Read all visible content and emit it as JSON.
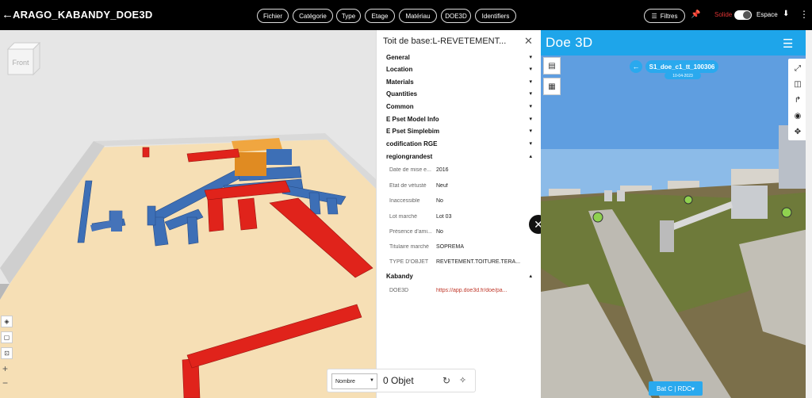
{
  "header": {
    "title": "ARAGO_KABANDY_DOE3D",
    "chips": [
      "Fichier",
      "Catégorie",
      "Type",
      "Etage",
      "Matériau",
      "DOE3D",
      "Identifiers"
    ],
    "filters_label": "Filtres",
    "solide_label": "Solide",
    "espace_label": "Espace"
  },
  "viewer": {
    "viewcube_label": "Front",
    "zoom_in": "+",
    "zoom_out": "−"
  },
  "panel": {
    "title": "Toit de base:L-REVETEMENT...",
    "sections": [
      "General",
      "Location",
      "Materials",
      "Quantities",
      "Common",
      "E Pset Model Info",
      "E Pset Simplebim",
      "codification RGE",
      "regiongrandest"
    ],
    "properties": [
      {
        "key": "Date de mise e...",
        "value": "2016"
      },
      {
        "key": "Etat de vétusté",
        "value": "Neuf"
      },
      {
        "key": "Inaccessible",
        "value": "No"
      },
      {
        "key": "Lot marché",
        "value": "Lot 03"
      },
      {
        "key": "Présence d'ami...",
        "value": "No"
      },
      {
        "key": "Titulaire marché",
        "value": "SOPREMA"
      },
      {
        "key": "TYPE D'OBJET",
        "value": "REVETEMENT.TOITURE.TERA..."
      }
    ],
    "kabandy_section": "Kabandy",
    "kabandy_properties": [
      {
        "key": "DOE3D",
        "value": "https://app.doe3d.fr/doe/pa..."
      }
    ]
  },
  "bottom_bar": {
    "select_value": "Nombre",
    "count_label": "0 Objet"
  },
  "doe3d": {
    "logo": "Doe 3D",
    "scene_name": "S1_doe_c1_tt_100306",
    "scene_date": "10-04-2023",
    "location_button": "Bat C | RDC"
  }
}
